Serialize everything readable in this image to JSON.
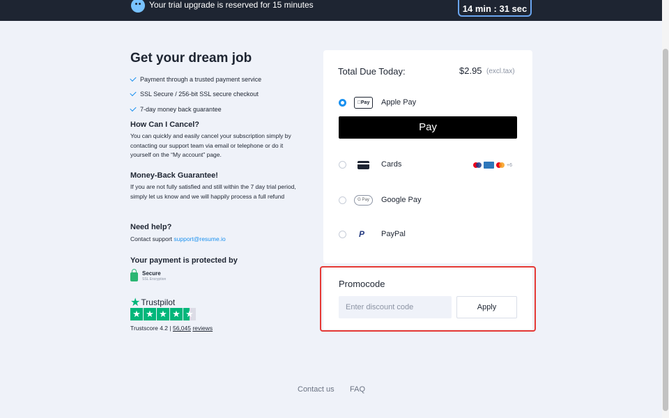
{
  "topbar": {
    "trial_text": "Your trial upgrade is reserved for 15 minutes",
    "timer": "14 min : 31 sec"
  },
  "left": {
    "title": "Get your dream job",
    "checks": [
      "Payment through a trusted payment service",
      "SSL Secure / 256-bit SSL secure checkout",
      "7-day money back guarantee"
    ],
    "cancel_title": "How Can I Cancel?",
    "cancel_text": "You can quickly and easily cancel your subscription simply by contacting our support team via email or telephone or do it yourself on the “My account” page.",
    "guarantee_title": "Money-Back Guarantee!",
    "guarantee_text": "If you are not fully satisfied and still within the 7 day trial period, simply let us know and we will happily process a full refund",
    "help_title": "Need help?",
    "help_prefix": "Contact support",
    "help_email": "support@resume.io",
    "protected_title": "Your payment is protected by",
    "secure_label": "Secure",
    "secure_sub": "SSL Encryption",
    "trustpilot_label": "Trustpilot",
    "trustscore_prefix": "Trustscore 4.2 |",
    "trustscore_count": "56,045",
    "trustscore_reviews": "reviews",
    "trustpilot_rating": 4.5
  },
  "payment": {
    "total_label": "Total Due Today:",
    "total_price": "$2.95",
    "excl_tax": "(excl.tax)",
    "methods": [
      {
        "label": "Apple Pay",
        "selected": true,
        "icon_text": "Pay"
      },
      {
        "label": "Cards",
        "selected": false,
        "extra": "+6"
      },
      {
        "label": "Google Pay",
        "selected": false,
        "icon_text": "G Pay"
      },
      {
        "label": "PayPal",
        "selected": false,
        "icon_text": "P"
      }
    ],
    "apple_button": " Pay"
  },
  "promo": {
    "title": "Promocode",
    "placeholder": "Enter discount code",
    "apply_label": "Apply"
  },
  "footer": {
    "contact": "Contact us",
    "faq": "FAQ"
  },
  "colors": {
    "accent": "#1a91f0",
    "topbar": "#1e2532",
    "highlight": "#e53935",
    "trustpilot": "#00b67a"
  }
}
